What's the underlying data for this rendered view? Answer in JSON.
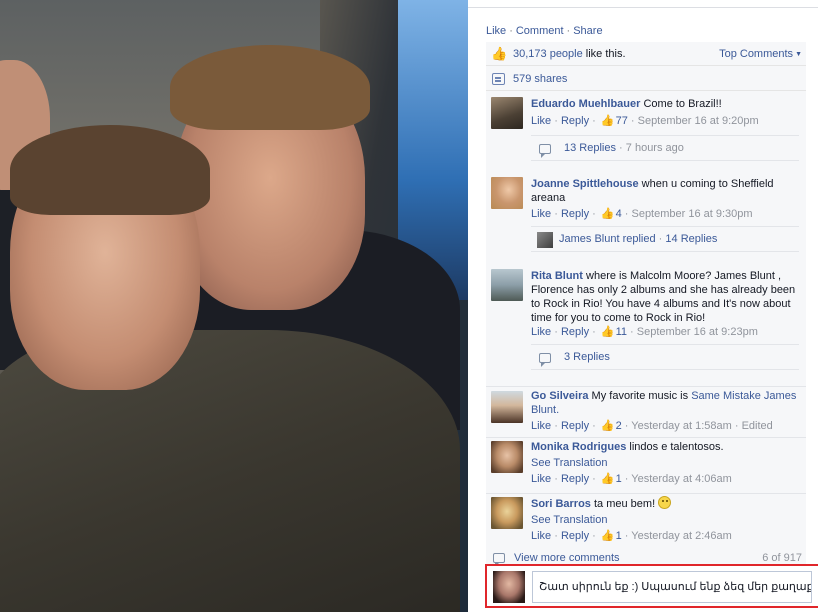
{
  "actions": {
    "like": "Like",
    "comment": "Comment",
    "share": "Share"
  },
  "summary": {
    "likes_count": "30,173 people",
    "likes_suffix": "like this.",
    "sort_label": "Top Comments",
    "shares": "579 shares"
  },
  "comments": [
    {
      "author": "Eduardo Muehlbauer",
      "text": "Come to Brazil!!",
      "like": "Like",
      "reply": "Reply",
      "likes": "77",
      "time": "September 16 at 9:20pm",
      "replies": {
        "label": "13 Replies",
        "time": "7 hours ago"
      }
    },
    {
      "author": "Joanne Spittlehouse",
      "text": "when u coming to Sheffield areana",
      "like": "Like",
      "reply": "Reply",
      "likes": "4",
      "time": "September 16 at 9:30pm",
      "replies": {
        "who": "James Blunt replied",
        "label": "14 Replies"
      }
    },
    {
      "author": "Rita Blunt",
      "text": "where is Malcolm Moore? James Blunt , Florence has only 2 albums and she has already been to Rock in Rio! You have 4 albums and It's now about time for you to come to Rock in Rio!",
      "like": "Like",
      "reply": "Reply",
      "likes": "11",
      "time": "September 16 at 9:23pm",
      "replies": {
        "label": "3 Replies"
      }
    },
    {
      "author": "Go Silveira",
      "text": "My favorite music is",
      "link_text": "Same Mistake James Blunt.",
      "like": "Like",
      "reply": "Reply",
      "likes": "2",
      "time": "Yesterday at 1:58am",
      "edited": "Edited"
    },
    {
      "author": "Monika Rodrigues",
      "text": "lindos e talentosos.",
      "see_translation": "See Translation",
      "like": "Like",
      "reply": "Reply",
      "likes": "1",
      "time": "Yesterday at 4:06am"
    },
    {
      "author": "Sori Barros",
      "text": "ta meu bem!",
      "see_translation": "See Translation",
      "like": "Like",
      "reply": "Reply",
      "likes": "1",
      "time": "Yesterday at 2:46am"
    }
  ],
  "view_more": {
    "label": "View more comments",
    "count": "6 of 917"
  },
  "composer": {
    "value": "Շատ սիրուն եք :) Սպասում ենք ձեզ մեր քաղաքում :)"
  },
  "icons": {
    "like": "thumbs-up-icon",
    "share": "share-icon",
    "reply": "reply-bubble-icon",
    "smiley": "smiley-emoji-icon"
  },
  "colors": {
    "link": "#3b5998",
    "meta": "#90949c",
    "panel": "#f6f7f9",
    "highlight": "#e0262b"
  }
}
